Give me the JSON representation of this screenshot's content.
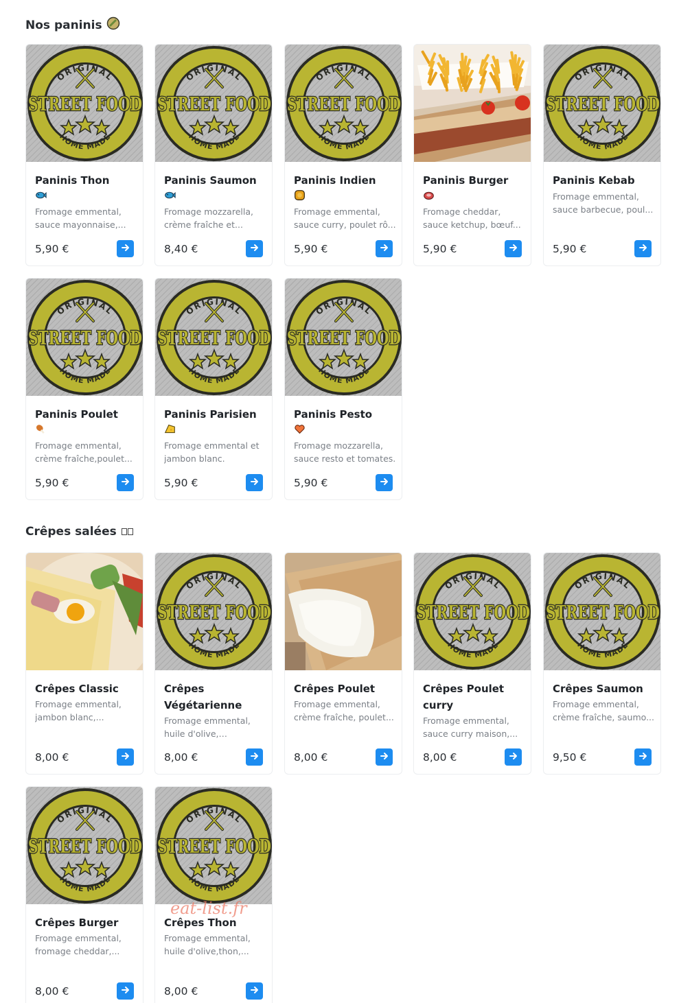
{
  "colors": {
    "accent": "#1d8cf0",
    "logo_olive": "#b9b532",
    "logo_dark": "#2a2b23",
    "logo_bg": "#b8b8b8"
  },
  "logo": {
    "top_text": "ORIGINAL",
    "main_text": "STREET FOOD",
    "bottom_text": "HOME MADE"
  },
  "sections": [
    {
      "title": "Nos paninis",
      "title_icon": "panini-icon",
      "items": [
        {
          "name": "Paninis Thon",
          "icons": [
            "panini-icon",
            "fish-icon"
          ],
          "description": "Fromage emmental, sauce mayonnaise,...",
          "price": "5,90 €",
          "image": "logo"
        },
        {
          "name": "Paninis Saumon",
          "icons": [
            "panini-icon",
            "fish-icon"
          ],
          "description": "Fromage mozzarella, crème fraîche et...",
          "price": "8,40 €",
          "image": "logo"
        },
        {
          "name": "Paninis Indien",
          "icons": [
            "panini-icon",
            "curry-icon"
          ],
          "description": "Fromage emmental, sauce curry, poulet rô...",
          "price": "5,90 €",
          "image": "logo"
        },
        {
          "name": "Paninis Burger",
          "icons": [
            "panini-icon",
            "meat-icon"
          ],
          "description": "Fromage cheddar, sauce ketchup, bœuf...",
          "price": "5,90 €",
          "image": "photo-panini-fries"
        },
        {
          "name": "Paninis Kebab",
          "icons": [
            "panini-icon"
          ],
          "description": "Fromage emmental, sauce barbecue, poul...",
          "price": "5,90 €",
          "image": "logo"
        },
        {
          "name": "Paninis Poulet",
          "icons": [
            "panini-icon",
            "chicken-leg-icon"
          ],
          "description": "Fromage emmental, crème fraîche,poulet...",
          "price": "5,90 €",
          "image": "logo"
        },
        {
          "name": "Paninis Parisien",
          "icons": [
            "panini-icon",
            "cheese-icon"
          ],
          "description": "Fromage emmental et jambon blanc.",
          "price": "5,90 €",
          "image": "logo"
        },
        {
          "name": "Paninis Pesto",
          "icons": [
            "panini-icon",
            "heart-icon"
          ],
          "description": "Fromage mozzarella, sauce resto et tomates.",
          "price": "5,90 €",
          "image": "logo"
        }
      ]
    },
    {
      "title": "Crêpes salées",
      "title_icon": "missing-glyph-icon",
      "items": [
        {
          "name": "Crêpes Classic",
          "description": "Fromage emmental, jambon blanc,...",
          "price": "8,00 €",
          "image": "photo-crepe-egg"
        },
        {
          "name": "Crêpes Végétarienne",
          "description": "Fromage emmental, huile d'olive, poivrons,...",
          "price": "8,00 €",
          "image": "logo"
        },
        {
          "name": "Crêpes Poulet",
          "description": "Fromage emmental, crème fraîche, poulet...",
          "price": "8,00 €",
          "image": "photo-crepe-cheese"
        },
        {
          "name": "Crêpes Poulet curry",
          "description": "Fromage emmental, sauce curry maison,...",
          "price": "8,00 €",
          "image": "logo"
        },
        {
          "name": "Crêpes Saumon",
          "description": "Fromage emmental, crème fraîche, saumo...",
          "price": "9,50 €",
          "image": "logo"
        },
        {
          "name": "Crêpes Burger",
          "description": "Fromage emmental, fromage cheddar,...",
          "price": "8,00 €",
          "image": "logo"
        },
        {
          "name": "Crêpes Thon",
          "description": "Fromage emmental, huile d'olive,thon,...",
          "price": "8,00 €",
          "image": "logo"
        }
      ]
    }
  ],
  "watermark": "eat-list.fr"
}
